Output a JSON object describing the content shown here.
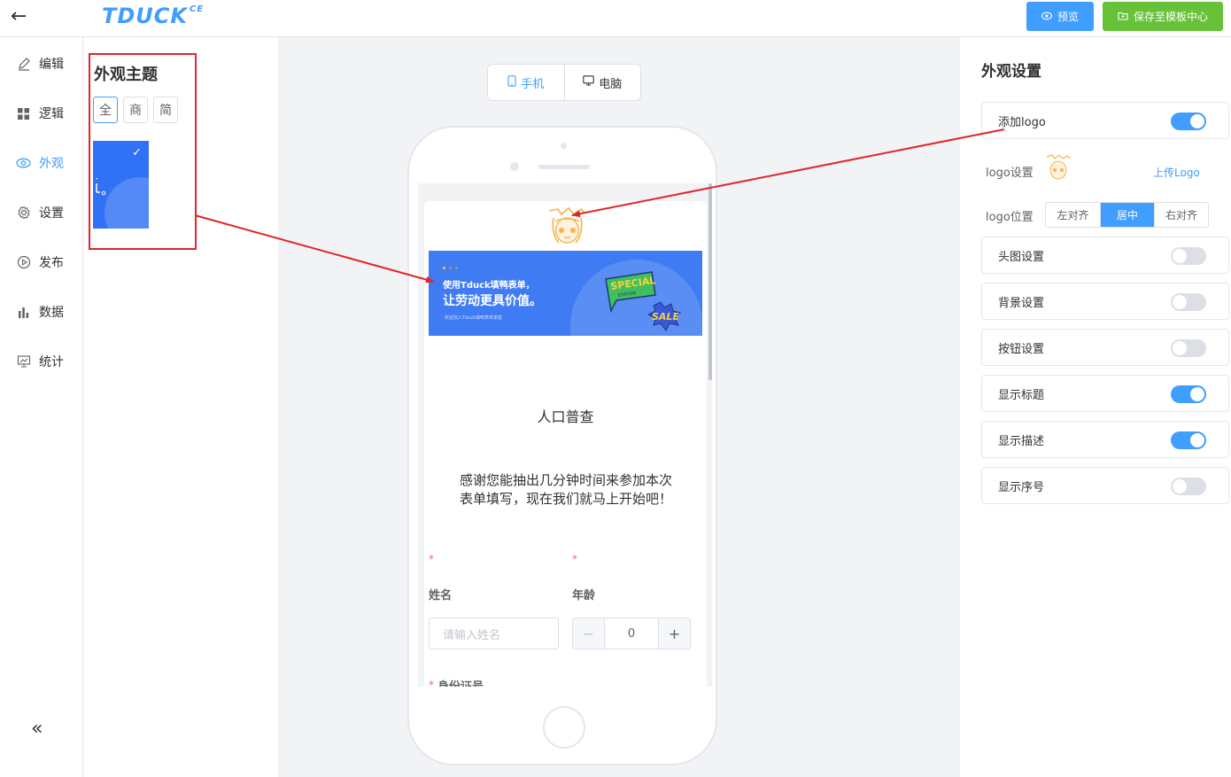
{
  "header": {
    "brand": "TDUCK",
    "brand_sup": "CE",
    "preview_label": "预览",
    "save_label": "保存至模板中心"
  },
  "sidebar": {
    "items": [
      {
        "label": "编辑"
      },
      {
        "label": "逻辑"
      },
      {
        "label": "外观",
        "active": true
      },
      {
        "label": "设置"
      },
      {
        "label": "发布"
      },
      {
        "label": "数据"
      },
      {
        "label": "统计"
      }
    ]
  },
  "theme_panel": {
    "title": "外观主题",
    "filters": [
      "全",
      "商",
      "简"
    ],
    "active_filter": "全"
  },
  "device_switch": {
    "mobile_label": "手机",
    "desktop_label": "电脑",
    "active": "手机"
  },
  "form_preview": {
    "banner_line1": "使用Tduck填鸭表单，",
    "banner_line2": "让劳动更具价值。",
    "banner_line3": "欢迎加入Tduck填鸭表单家庭",
    "title": "人口普查",
    "description": "感谢您能抽出几分钟时间来参加本次表单填写，现在我们就马上开始吧！",
    "fields": [
      {
        "label": "姓名",
        "required": true,
        "placeholder": "请输入姓名"
      },
      {
        "label": "年龄",
        "required": true,
        "value": "0"
      },
      {
        "label": "身份证号",
        "required": true
      }
    ]
  },
  "settings": {
    "title": "外观设置",
    "add_logo_label": "添加logo",
    "add_logo_on": true,
    "logo_settings_label": "logo设置",
    "upload_logo_label": "上传Logo",
    "logo_position_label": "logo位置",
    "logo_positions": [
      "左对齐",
      "居中",
      "右对齐"
    ],
    "logo_position_active": "居中",
    "toggles": [
      {
        "label": "头图设置",
        "on": false
      },
      {
        "label": "背景设置",
        "on": false
      },
      {
        "label": "按钮设置",
        "on": false
      },
      {
        "label": "显示标题",
        "on": true
      },
      {
        "label": "显示描述",
        "on": true
      },
      {
        "label": "显示序号",
        "on": false
      }
    ]
  },
  "colors": {
    "primary": "#409eff",
    "success": "#67c23a",
    "annotation_red": "#e0262b",
    "theme_blue": "#3071f5"
  }
}
